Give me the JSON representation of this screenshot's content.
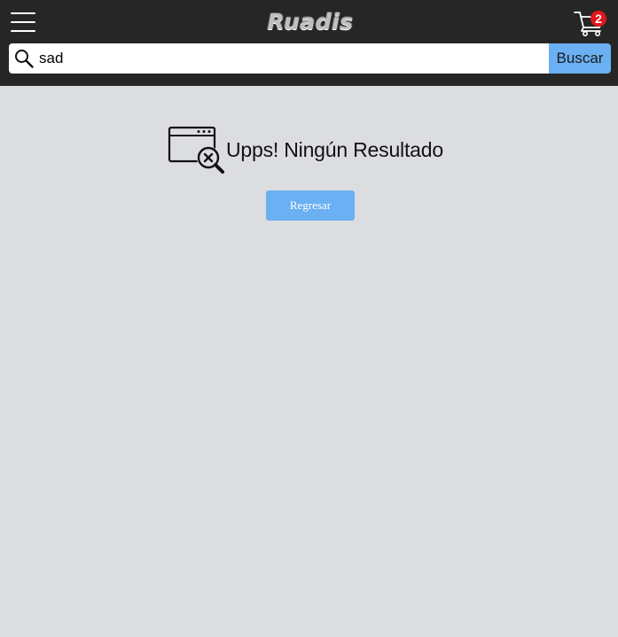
{
  "header": {
    "logo_text": "Ruadis",
    "cart": {
      "count": "2",
      "badge_color": "#e3151b"
    }
  },
  "search": {
    "value": "sad",
    "button_label": "Buscar"
  },
  "results": {
    "empty_title": "Upps! Ningún Resultado",
    "back_button_label": "Regresar"
  },
  "colors": {
    "accent": "#6ab0f3",
    "header_bg": "#262626",
    "page_bg": "#dcdde0"
  },
  "icons": [
    "menu-icon",
    "cart-icon",
    "search-icon",
    "no-results-icon"
  ]
}
